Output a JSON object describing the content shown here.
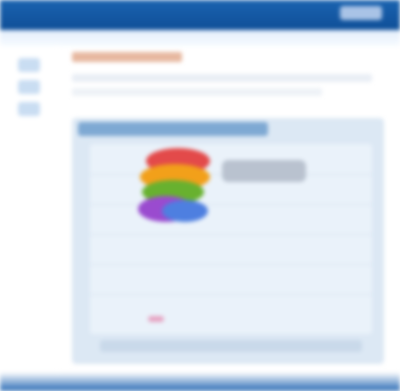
{
  "header": {
    "title": ""
  },
  "panel": {
    "title": ""
  },
  "colors": {
    "header_blue": "#1a63b0",
    "panel_bg": "#dce8f4",
    "accent_red": "#e34a4a",
    "accent_orange": "#f2a01a",
    "accent_green": "#68b12f",
    "accent_purple": "#9a4bcf",
    "accent_blue": "#4e7fe0"
  },
  "icons": [
    "avatar-icon",
    "app-icon",
    "menu-icon"
  ]
}
